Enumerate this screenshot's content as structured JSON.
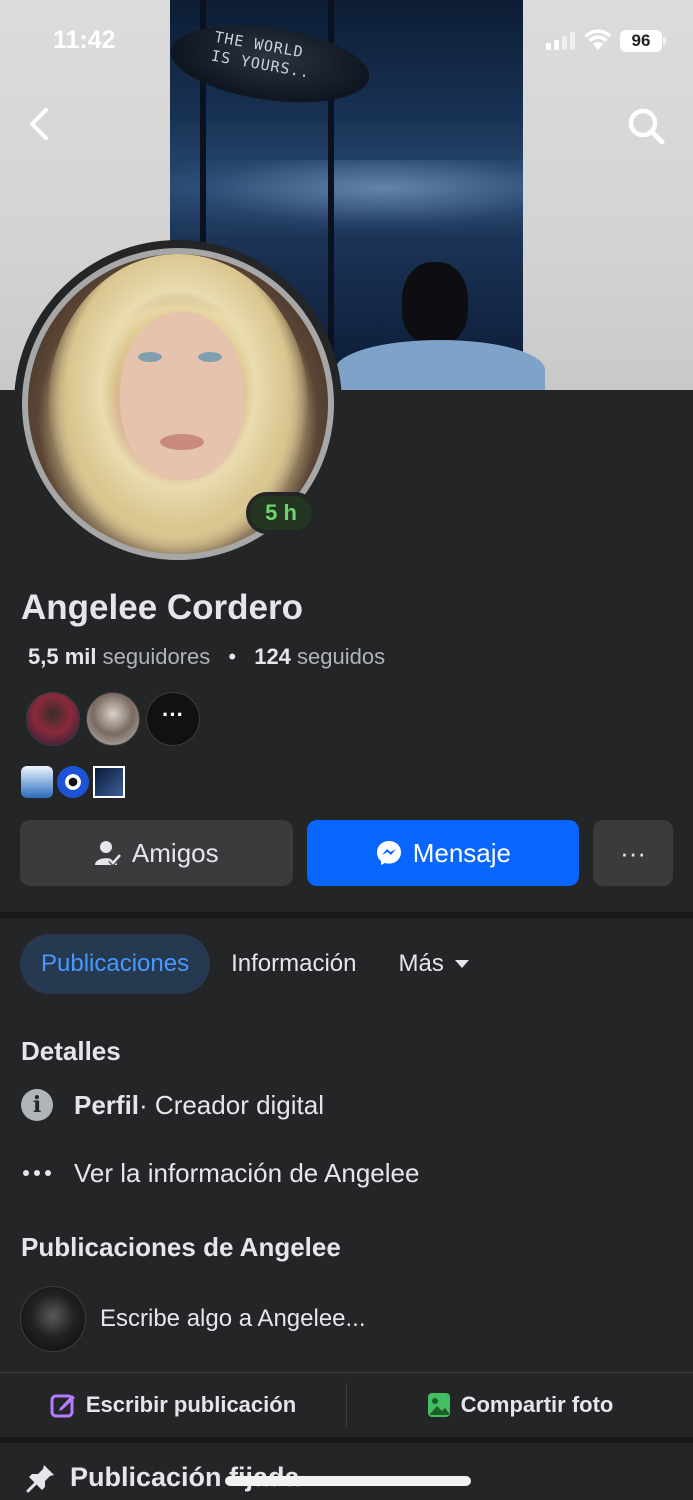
{
  "status_bar": {
    "time": "11:42",
    "battery": "96"
  },
  "cover": {
    "blimp_text_line1": "THE WORLD",
    "blimp_text_line2": "IS YOURS.."
  },
  "profile": {
    "name": "Angelee Cordero",
    "story_badge": "5 h",
    "followers_count": "5,5 mil",
    "followers_label": "seguidores",
    "separator": "•",
    "following_count": "124",
    "following_label": "seguidos",
    "mutual_more": "···"
  },
  "actions": {
    "friends_label": "Amigos",
    "message_label": "Mensaje",
    "more_label": "···"
  },
  "tabs": [
    {
      "label": "Publicaciones",
      "active": true
    },
    {
      "label": "Información",
      "active": false
    },
    {
      "label": "Más",
      "active": false
    }
  ],
  "details": {
    "title": "Detalles",
    "profile_label": "Perfil",
    "profile_value": " · Creador digital",
    "see_info": "Ver la información de Angelee"
  },
  "posts": {
    "title": "Publicaciones de Angelee",
    "composer_placeholder": "Escribe algo a Angelee...",
    "write_post": "Escribir publicación",
    "share_photo": "Compartir foto",
    "pinned": "Publicación fijada"
  },
  "colors": {
    "background": "#242526",
    "accent_blue": "#0866ff",
    "active_tab_bg": "#263951",
    "active_tab_text": "#4599ff",
    "story_green": "#6cd46a"
  }
}
